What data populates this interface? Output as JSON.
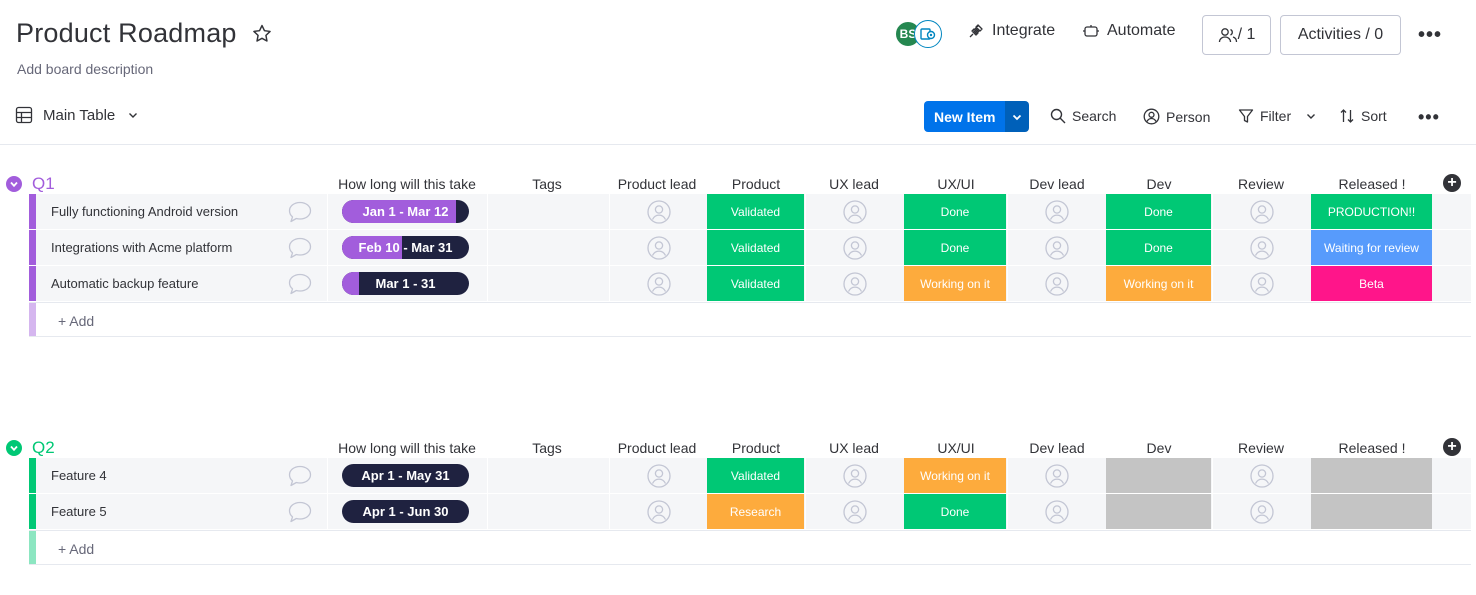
{
  "board": {
    "title": "Product Roadmap",
    "description": "Add board description"
  },
  "header": {
    "avatar_initials": "BS",
    "integrate_label": "Integrate",
    "automate_label": "Automate",
    "members_label": "/ 1",
    "activities_label": "Activities / 0",
    "more_label": "•••"
  },
  "toolbar": {
    "view_label": "Main Table",
    "new_item_label": "New Item",
    "search_label": "Search",
    "person_label": "Person",
    "filter_label": "Filter",
    "sort_label": "Sort",
    "more_label": "•••"
  },
  "columns": {
    "timeline": "How long will this take",
    "tags": "Tags",
    "product_lead": "Product lead",
    "product": "Product",
    "ux_lead": "UX lead",
    "ux_ui": "UX/UI",
    "dev_lead": "Dev lead",
    "dev": "Dev",
    "review": "Review",
    "released": "Released !"
  },
  "colors": {
    "accent": "#0073ea",
    "green": "#00c875",
    "orange": "#fdab3d",
    "blue": "#579bfc",
    "pink": "#ff158a",
    "purple": "#a25ddc",
    "empty": "#c4c4c4",
    "timeline_dark": "#1f2240"
  },
  "groups": [
    {
      "name": "Q1",
      "color": "#a25ddc",
      "add_label": "+ Add",
      "rows": [
        {
          "name": "Fully functioning Android version",
          "timeline": "Jan 1 - Mar 12",
          "timeline_progress": 0.9,
          "product": "Validated",
          "product_color": "#00c875",
          "ux_ui": "Done",
          "ux_ui_color": "#00c875",
          "dev": "Done",
          "dev_color": "#00c875",
          "released": "PRODUCTION!!",
          "released_color": "#00c875"
        },
        {
          "name": "Integrations with Acme platform",
          "timeline": "Feb 10 - Mar 31",
          "timeline_progress": 0.47,
          "product": "Validated",
          "product_color": "#00c875",
          "ux_ui": "Done",
          "ux_ui_color": "#00c875",
          "dev": "Done",
          "dev_color": "#00c875",
          "released": "Waiting for review",
          "released_color": "#579bfc"
        },
        {
          "name": "Automatic backup feature",
          "timeline": "Mar 1 - 31",
          "timeline_progress": 0.13,
          "product": "Validated",
          "product_color": "#00c875",
          "ux_ui": "Working on it",
          "ux_ui_color": "#fdab3d",
          "dev": "Working on it",
          "dev_color": "#fdab3d",
          "released": "Beta",
          "released_color": "#ff158a"
        }
      ]
    },
    {
      "name": "Q2",
      "color": "#00c875",
      "add_label": "+ Add",
      "rows": [
        {
          "name": "Feature 4",
          "timeline": "Apr 1 - May 31",
          "timeline_progress": 0,
          "product": "Validated",
          "product_color": "#00c875",
          "ux_ui": "Working on it",
          "ux_ui_color": "#fdab3d",
          "dev": "",
          "dev_color": "#c4c4c4",
          "released": "",
          "released_color": "#c4c4c4"
        },
        {
          "name": "Feature 5",
          "timeline": "Apr 1 - Jun 30",
          "timeline_progress": 0,
          "product": "Research",
          "product_color": "#fdab3d",
          "ux_ui": "Done",
          "ux_ui_color": "#00c875",
          "dev": "",
          "dev_color": "#c4c4c4",
          "released": "",
          "released_color": "#c4c4c4"
        }
      ]
    }
  ]
}
